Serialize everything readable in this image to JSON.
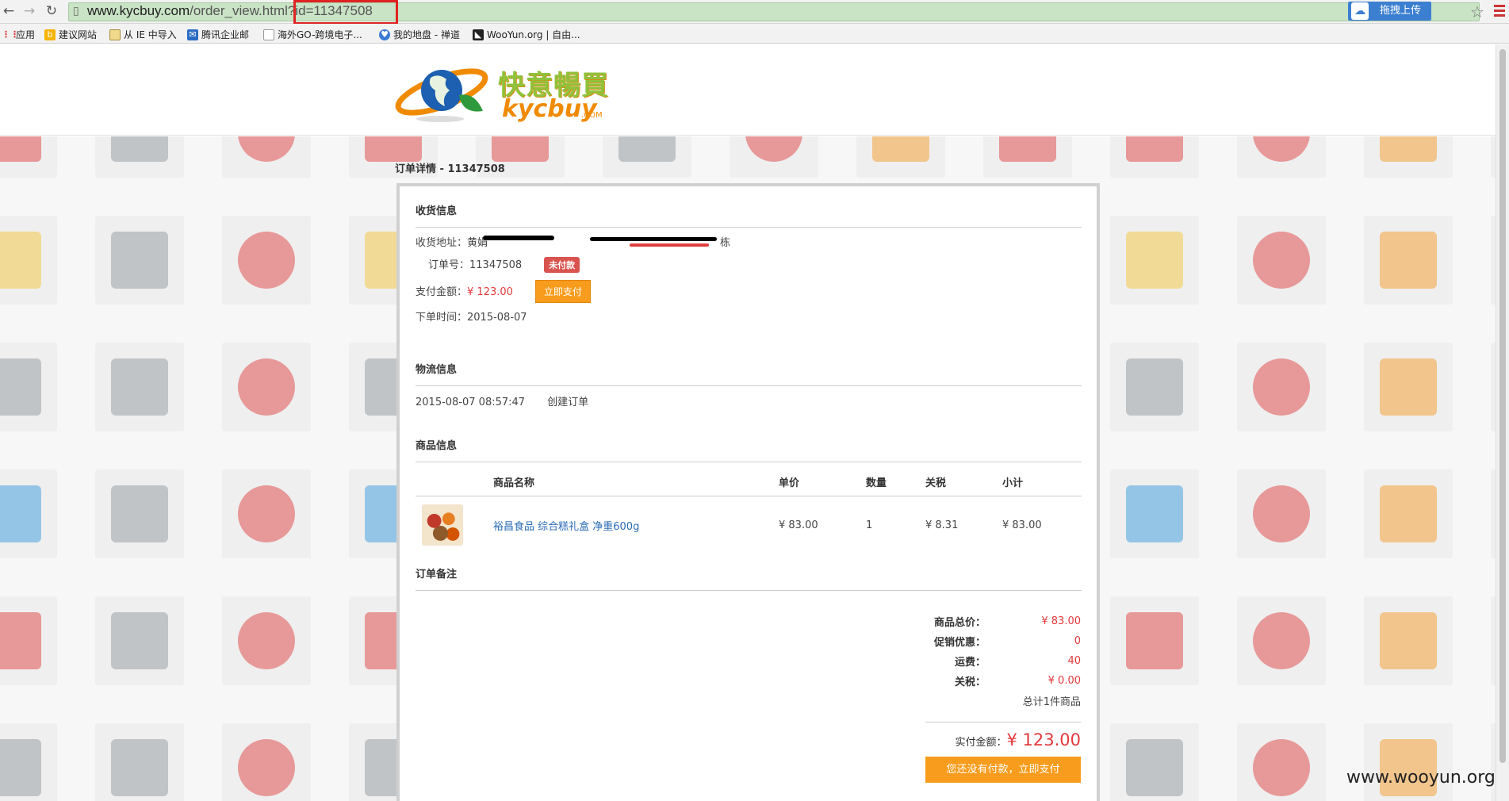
{
  "browser": {
    "url_host": "www.kycbuy.com",
    "url_path": "/order_view.html",
    "url_query": "?id=11347508",
    "extension_label": "拖拽上传",
    "bookmarks": [
      "应用",
      "建议网站",
      "从 IE 中导入",
      "腾讯企业邮",
      "海外GO-跨境电子...",
      "我的地盘 - 禅道",
      "WooYun.org | 自由..."
    ]
  },
  "logo": {
    "cn": "快意暢買",
    "en": "kycbuy",
    "com": ".COM"
  },
  "order": {
    "heading": "订单详情 - 11347508",
    "shipping": {
      "title": "收货信息",
      "address_label": "收货地址：",
      "address_name": "黄娟",
      "address_tail": "栋",
      "order_no_label": "订单号：",
      "order_no": "11347508",
      "status": "未付款",
      "amount_label": "支付金额：",
      "amount": "¥ 123.00",
      "pay_now": "立即支付",
      "time_label": "下单时间：",
      "time": "2015-08-07"
    },
    "logistics": {
      "title": "物流信息",
      "time": "2015-08-07 08:57:47",
      "event": "创建订单"
    },
    "products": {
      "title": "商品信息",
      "headers": [
        "商品名称",
        "单价",
        "数量",
        "关税",
        "小计"
      ],
      "rows": [
        {
          "name": "裕昌食品 综合糕礼盒 净重600g",
          "price": "¥ 83.00",
          "qty": "1",
          "tax": "¥ 8.31",
          "subtotal": "¥ 83.00"
        }
      ]
    },
    "remark": {
      "title": "订单备注"
    },
    "totals": [
      {
        "label": "商品总价：",
        "value": "¥ 83.00"
      },
      {
        "label": "促销优惠：",
        "value": "0"
      },
      {
        "label": "运费：",
        "value": "40"
      },
      {
        "label": "关税：",
        "value": "¥ 0.00"
      }
    ],
    "item_count": "总计1件商品",
    "paid_label": "实付金额：",
    "paid_value": "¥ 123.00",
    "pay_button": "您还没有付款，立即支付"
  },
  "watermark": "www.wooyun.org",
  "colors": {
    "accent": "#f79c1c",
    "price": "#e4393c",
    "badge": "#d9534f",
    "link": "#2a6bb5"
  }
}
